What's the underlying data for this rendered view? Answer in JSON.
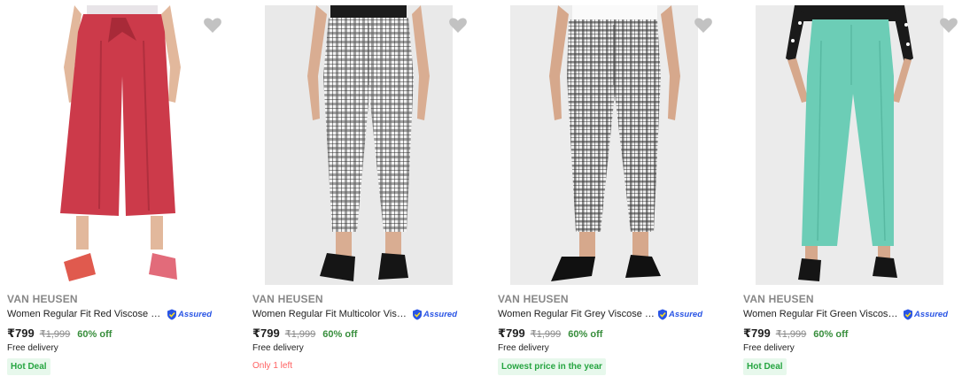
{
  "colors": {
    "brand_grey": "#878787",
    "offer_green": "#388e3c",
    "badge_green": "#26a541",
    "badge_bg": "#e7f8ec",
    "stock_red": "#ff6161",
    "assured_blue": "#2a55e5"
  },
  "products": [
    {
      "brand": "VAN HEUSEN",
      "title": "Women Regular Fit Red Viscose Rayon Trousers",
      "assured_label": "Assured",
      "price": "₹799",
      "mrp": "₹1,999",
      "discount": "60% off",
      "delivery": "Free delivery",
      "badge": "Hot Deal",
      "stock_note": "",
      "image_icon": "red-culottes-photo",
      "wishlist_icon": "heart-icon"
    },
    {
      "brand": "VAN HEUSEN",
      "title": "Women Regular Fit Multicolor Viscose Rayon Trousers",
      "assured_label": "Assured",
      "price": "₹799",
      "mrp": "₹1,999",
      "discount": "60% off",
      "delivery": "Free delivery",
      "badge": "",
      "stock_note": "Only 1 left",
      "image_icon": "checked-trousers-photo",
      "wishlist_icon": "heart-icon"
    },
    {
      "brand": "VAN HEUSEN",
      "title": "Women Regular Fit Grey Viscose Rayon Trousers",
      "assured_label": "Assured",
      "price": "₹799",
      "mrp": "₹1,999",
      "discount": "60% off",
      "delivery": "Free delivery",
      "badge": "Lowest price in the year",
      "stock_note": "",
      "image_icon": "grey-checked-trousers-photo",
      "wishlist_icon": "heart-icon"
    },
    {
      "brand": "VAN HEUSEN",
      "title": "Women Regular Fit Green Viscose Rayon Trousers",
      "assured_label": "Assured",
      "price": "₹799",
      "mrp": "₹1,999",
      "discount": "60% off",
      "delivery": "Free delivery",
      "badge": "Hot Deal",
      "stock_note": "",
      "image_icon": "green-trousers-photo",
      "wishlist_icon": "heart-icon"
    }
  ]
}
